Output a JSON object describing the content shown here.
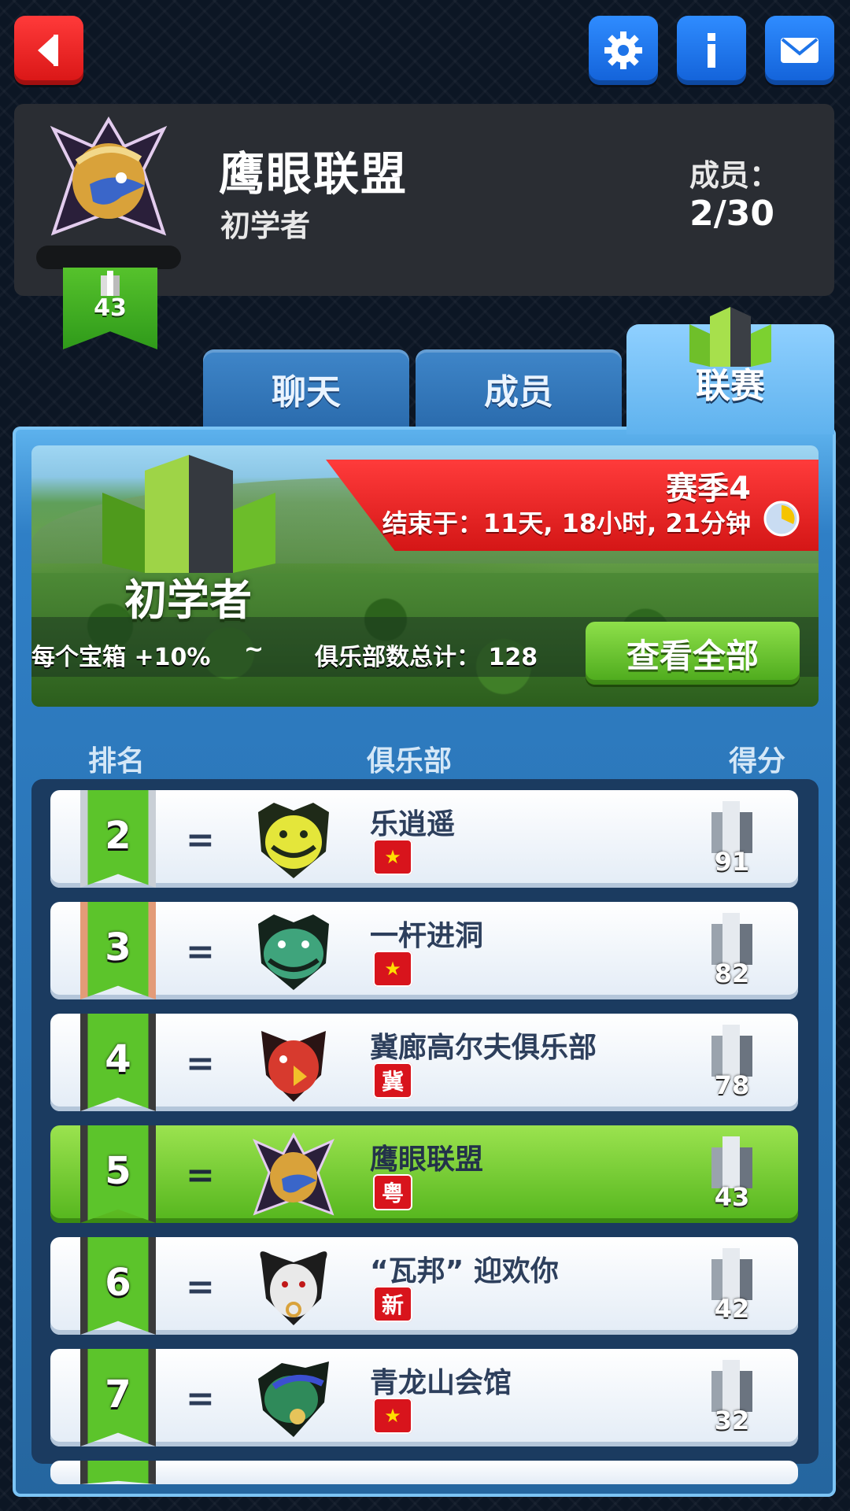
{
  "header": {
    "club_name": "鹰眼联盟",
    "club_tier": "初学者",
    "members_label": "成员：",
    "members_count": "2/30",
    "club_points": "43"
  },
  "tabs": [
    {
      "label": "聊天"
    },
    {
      "label": "成员"
    },
    {
      "label": "联赛",
      "active": true
    }
  ],
  "banner": {
    "season_title": "赛季4",
    "season_ends": "结束于：11天, 18小时, 21分钟",
    "tier": "初学者",
    "chest_bonus": "每个宝箱 +10%",
    "tilde": "~",
    "club_total": "俱乐部数总计： 128",
    "view_all": "查看全部"
  },
  "columns": {
    "rank": "排名",
    "club": "俱乐部",
    "score": "得分"
  },
  "rows": [
    {
      "rank": "2",
      "change": "=",
      "name": "乐逍遥",
      "region": "",
      "score": "91"
    },
    {
      "rank": "3",
      "change": "=",
      "name": "一杆进洞",
      "region": "",
      "score": "82"
    },
    {
      "rank": "4",
      "change": "=",
      "name": "冀廊高尔夫俱乐部",
      "region": "冀",
      "score": "78"
    },
    {
      "rank": "5",
      "change": "=",
      "name": "鹰眼联盟",
      "region": "粤",
      "score": "43"
    },
    {
      "rank": "6",
      "change": "=",
      "name": "“瓦邦” 迎欢你",
      "region": "新",
      "score": "42"
    },
    {
      "rank": "7",
      "change": "=",
      "name": "青龙山会馆",
      "region": "",
      "score": "32"
    }
  ],
  "colors": {
    "accent_green": "#5cc42b",
    "accent_red": "#d81515",
    "accent_blue": "#2f8cff"
  }
}
